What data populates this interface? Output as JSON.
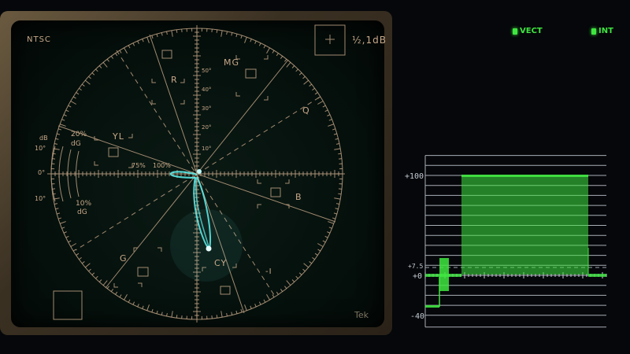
{
  "vectorscope": {
    "standard": "NTSC",
    "gain_label": "½,1dB",
    "brand": "Tek",
    "targets": {
      "r": "R",
      "mg": "MG",
      "b": "B",
      "cy": "CY",
      "g": "G",
      "yl": "YL"
    },
    "axes": {
      "q": "Q",
      "i": "-I"
    },
    "percent_marks": {
      "p75": "75%",
      "p100": "100%"
    },
    "degree_marks": [
      "50°",
      "40°",
      "30°",
      "20°",
      "10°"
    ],
    "left_scale": {
      "db_label": "dB",
      "top_deg": "10°",
      "mid_deg": "0°",
      "bot_deg": "10°",
      "top_pct": "20%",
      "top_dg": "dG",
      "bot_pct": "10%",
      "bot_dg": "dG"
    }
  },
  "indicators": {
    "vect": "VECT",
    "int": "INT"
  },
  "waveform": {
    "labels": {
      "p100": "+100",
      "p7_5": "+7.5",
      "p0": "+0",
      "m40": "-40"
    }
  },
  "colors": {
    "graticule": "#c9a98a",
    "trace": "#5ff3f0",
    "waveform": "#3fe640",
    "wfm_grid": "#c6ccd6"
  }
}
